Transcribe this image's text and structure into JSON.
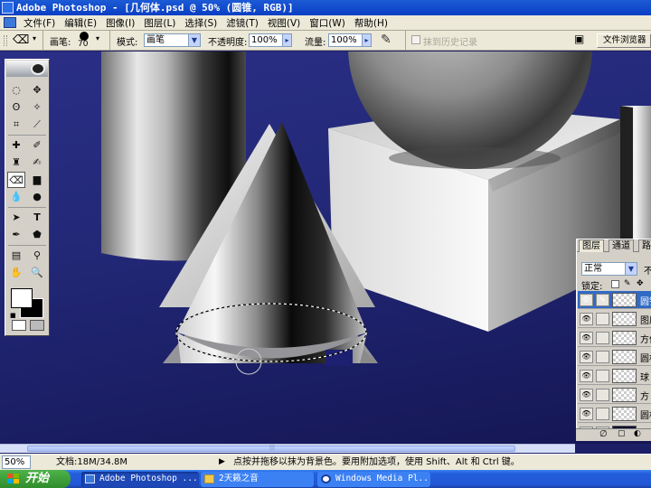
{
  "window": {
    "title": "Adobe Photoshop - [几何体.psd @ 50% (圆锥, RGB)]"
  },
  "menu": [
    {
      "label": "文件(F)"
    },
    {
      "label": "编辑(E)"
    },
    {
      "label": "图像(I)"
    },
    {
      "label": "图层(L)"
    },
    {
      "label": "选择(S)"
    },
    {
      "label": "滤镜(T)"
    },
    {
      "label": "视图(V)"
    },
    {
      "label": "窗口(W)"
    },
    {
      "label": "帮助(H)"
    }
  ],
  "options": {
    "brush_label": "画笔:",
    "brush_size": "70",
    "mode_label": "模式:",
    "mode_value": "画笔",
    "opacity_label": "不透明度:",
    "opacity_value": "100%",
    "flow_label": "流量:",
    "flow_value": "100%",
    "history_label": "抹到历史记录",
    "file_browser": "文件浏览器"
  },
  "layers_panel": {
    "tabs": [
      "图层",
      "通道",
      "路"
    ],
    "blend_mode": "正常",
    "opacity_prefix": "不",
    "lock_label": "锁定:",
    "layers": [
      {
        "name": "圆锥",
        "active": true
      },
      {
        "name": "图层"
      },
      {
        "name": "方体"
      },
      {
        "name": "圆柱"
      },
      {
        "name": "球"
      },
      {
        "name": "方"
      },
      {
        "name": "圆柱"
      },
      {
        "name": "背"
      }
    ]
  },
  "status": {
    "zoom": "50%",
    "doc": "文档:18M/34.8M",
    "hint": "点按并拖移以抹为背景色。要用附加选项，使用 Shift、Alt 和 Ctrl 键。"
  },
  "taskbar": {
    "start": "开始",
    "tasks": [
      {
        "label": "Adobe Photoshop ..."
      },
      {
        "label": "2天籁之音"
      },
      {
        "label": "Windows Media Pl..."
      }
    ]
  },
  "colors": {
    "canvas_bg": "#222775",
    "titlebar": "#0a3fc4",
    "selection": "#316ac5",
    "taskbar": "#245edb",
    "start": "#2f8e2b"
  }
}
